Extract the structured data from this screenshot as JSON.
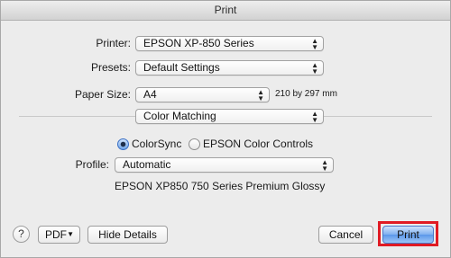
{
  "window": {
    "title": "Print"
  },
  "printer": {
    "label": "Printer:",
    "value": "EPSON XP-850 Series"
  },
  "presets": {
    "label": "Presets:",
    "value": "Default Settings"
  },
  "paper": {
    "label": "Paper Size:",
    "value": "A4",
    "dimensions": "210 by 297 mm"
  },
  "section": {
    "value": "Color Matching"
  },
  "color_mode": {
    "options": [
      {
        "label": "ColorSync",
        "selected": true
      },
      {
        "label": "EPSON Color Controls",
        "selected": false
      }
    ]
  },
  "profile": {
    "label": "Profile:",
    "value": "Automatic",
    "description": "EPSON XP850 750 Series Premium Glossy"
  },
  "footer": {
    "help_label": "?",
    "pdf_label": "PDF",
    "hide_details_label": "Hide Details",
    "cancel_label": "Cancel",
    "print_label": "Print"
  },
  "colors": {
    "highlight": "#e01b24",
    "accent": "#5b97ea"
  }
}
